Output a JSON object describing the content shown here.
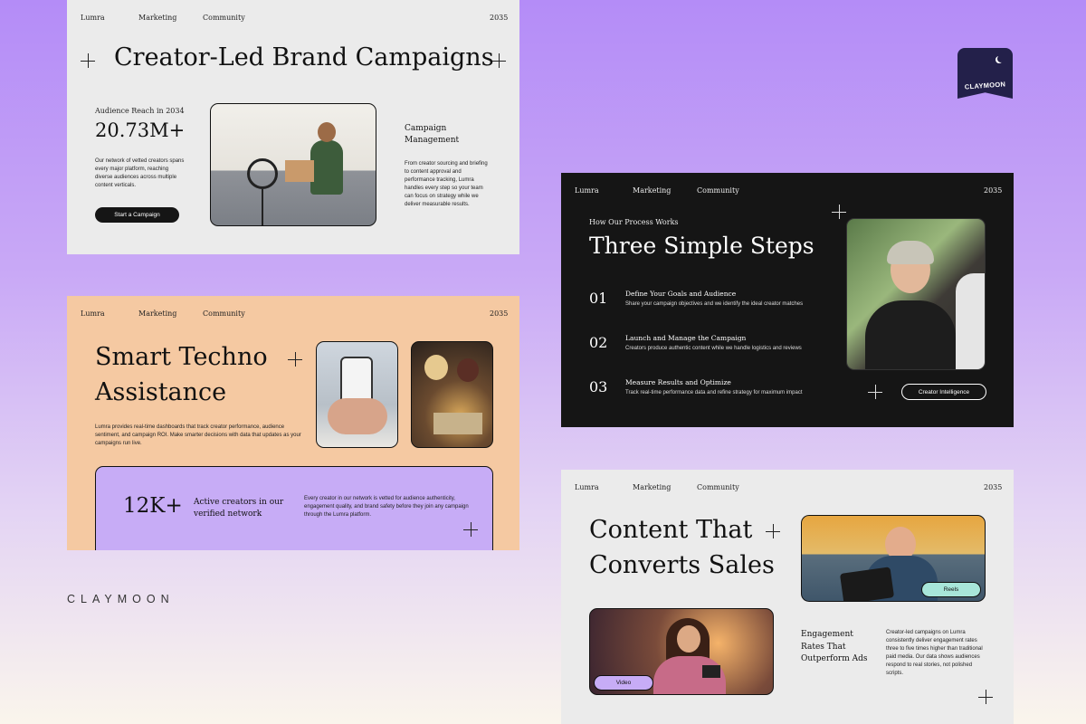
{
  "brand": {
    "wordmark": "CLAYMOON",
    "logo_text": "CLAYMOON",
    "accent": "#b48cf7"
  },
  "nav": {
    "brand": "Lumra",
    "marketing": "Marketing",
    "community": "Community",
    "year": "2035"
  },
  "slide1": {
    "title": "Creator-Led Brand Campaigns",
    "stat_label": "Audience Reach in 2034",
    "stat_value": "20.73M+",
    "stat_desc": "Our network of vetted creators spans every major platform, reaching diverse audiences across multiple content verticals.",
    "cta": "Start a Campaign",
    "section_title": "Campaign Management",
    "section_desc": "From creator sourcing and briefing to content approval and performance tracking, Lumra handles every step so your team can focus on strategy while we deliver measurable results."
  },
  "slide2": {
    "title_line1": "Smart Techno",
    "title_line2": "Assistance",
    "desc": "Lumra provides real-time dashboards that track creator performance, audience sentiment, and campaign ROI. Make smarter decisions with data that updates as your campaigns run live.",
    "stat_value": "12K+",
    "stat_label": "Active creators in our verified network",
    "stat_desc": "Every creator in our network is vetted for audience authenticity, engagement quality, and brand safety before they join any campaign through the Lumra platform."
  },
  "slide3": {
    "eyebrow": "How Our Process Works",
    "title": "Three Simple Steps",
    "steps": [
      {
        "num": "01",
        "title": "Define Your Goals and Audience",
        "desc": "Share your campaign objectives and we identify the ideal creator matches"
      },
      {
        "num": "02",
        "title": "Launch and Manage the Campaign",
        "desc": "Creators produce authentic content while we handle logistics and reviews"
      },
      {
        "num": "03",
        "title": "Measure Results and Optimize",
        "desc": "Track real-time performance data and refine strategy for maximum impact"
      }
    ],
    "cta": "Creator Intelligence"
  },
  "slide4": {
    "title_line1": "Content That",
    "title_line2": "Converts Sales",
    "tag_reels": "Reels",
    "tag_video": "Video",
    "section_title": "Engagement Rates That Outperform Ads",
    "section_desc": "Creator-led campaigns on Lumra consistently deliver engagement rates three to five times higher than traditional paid media. Our data shows audiences respond to real stories, not polished scripts."
  }
}
